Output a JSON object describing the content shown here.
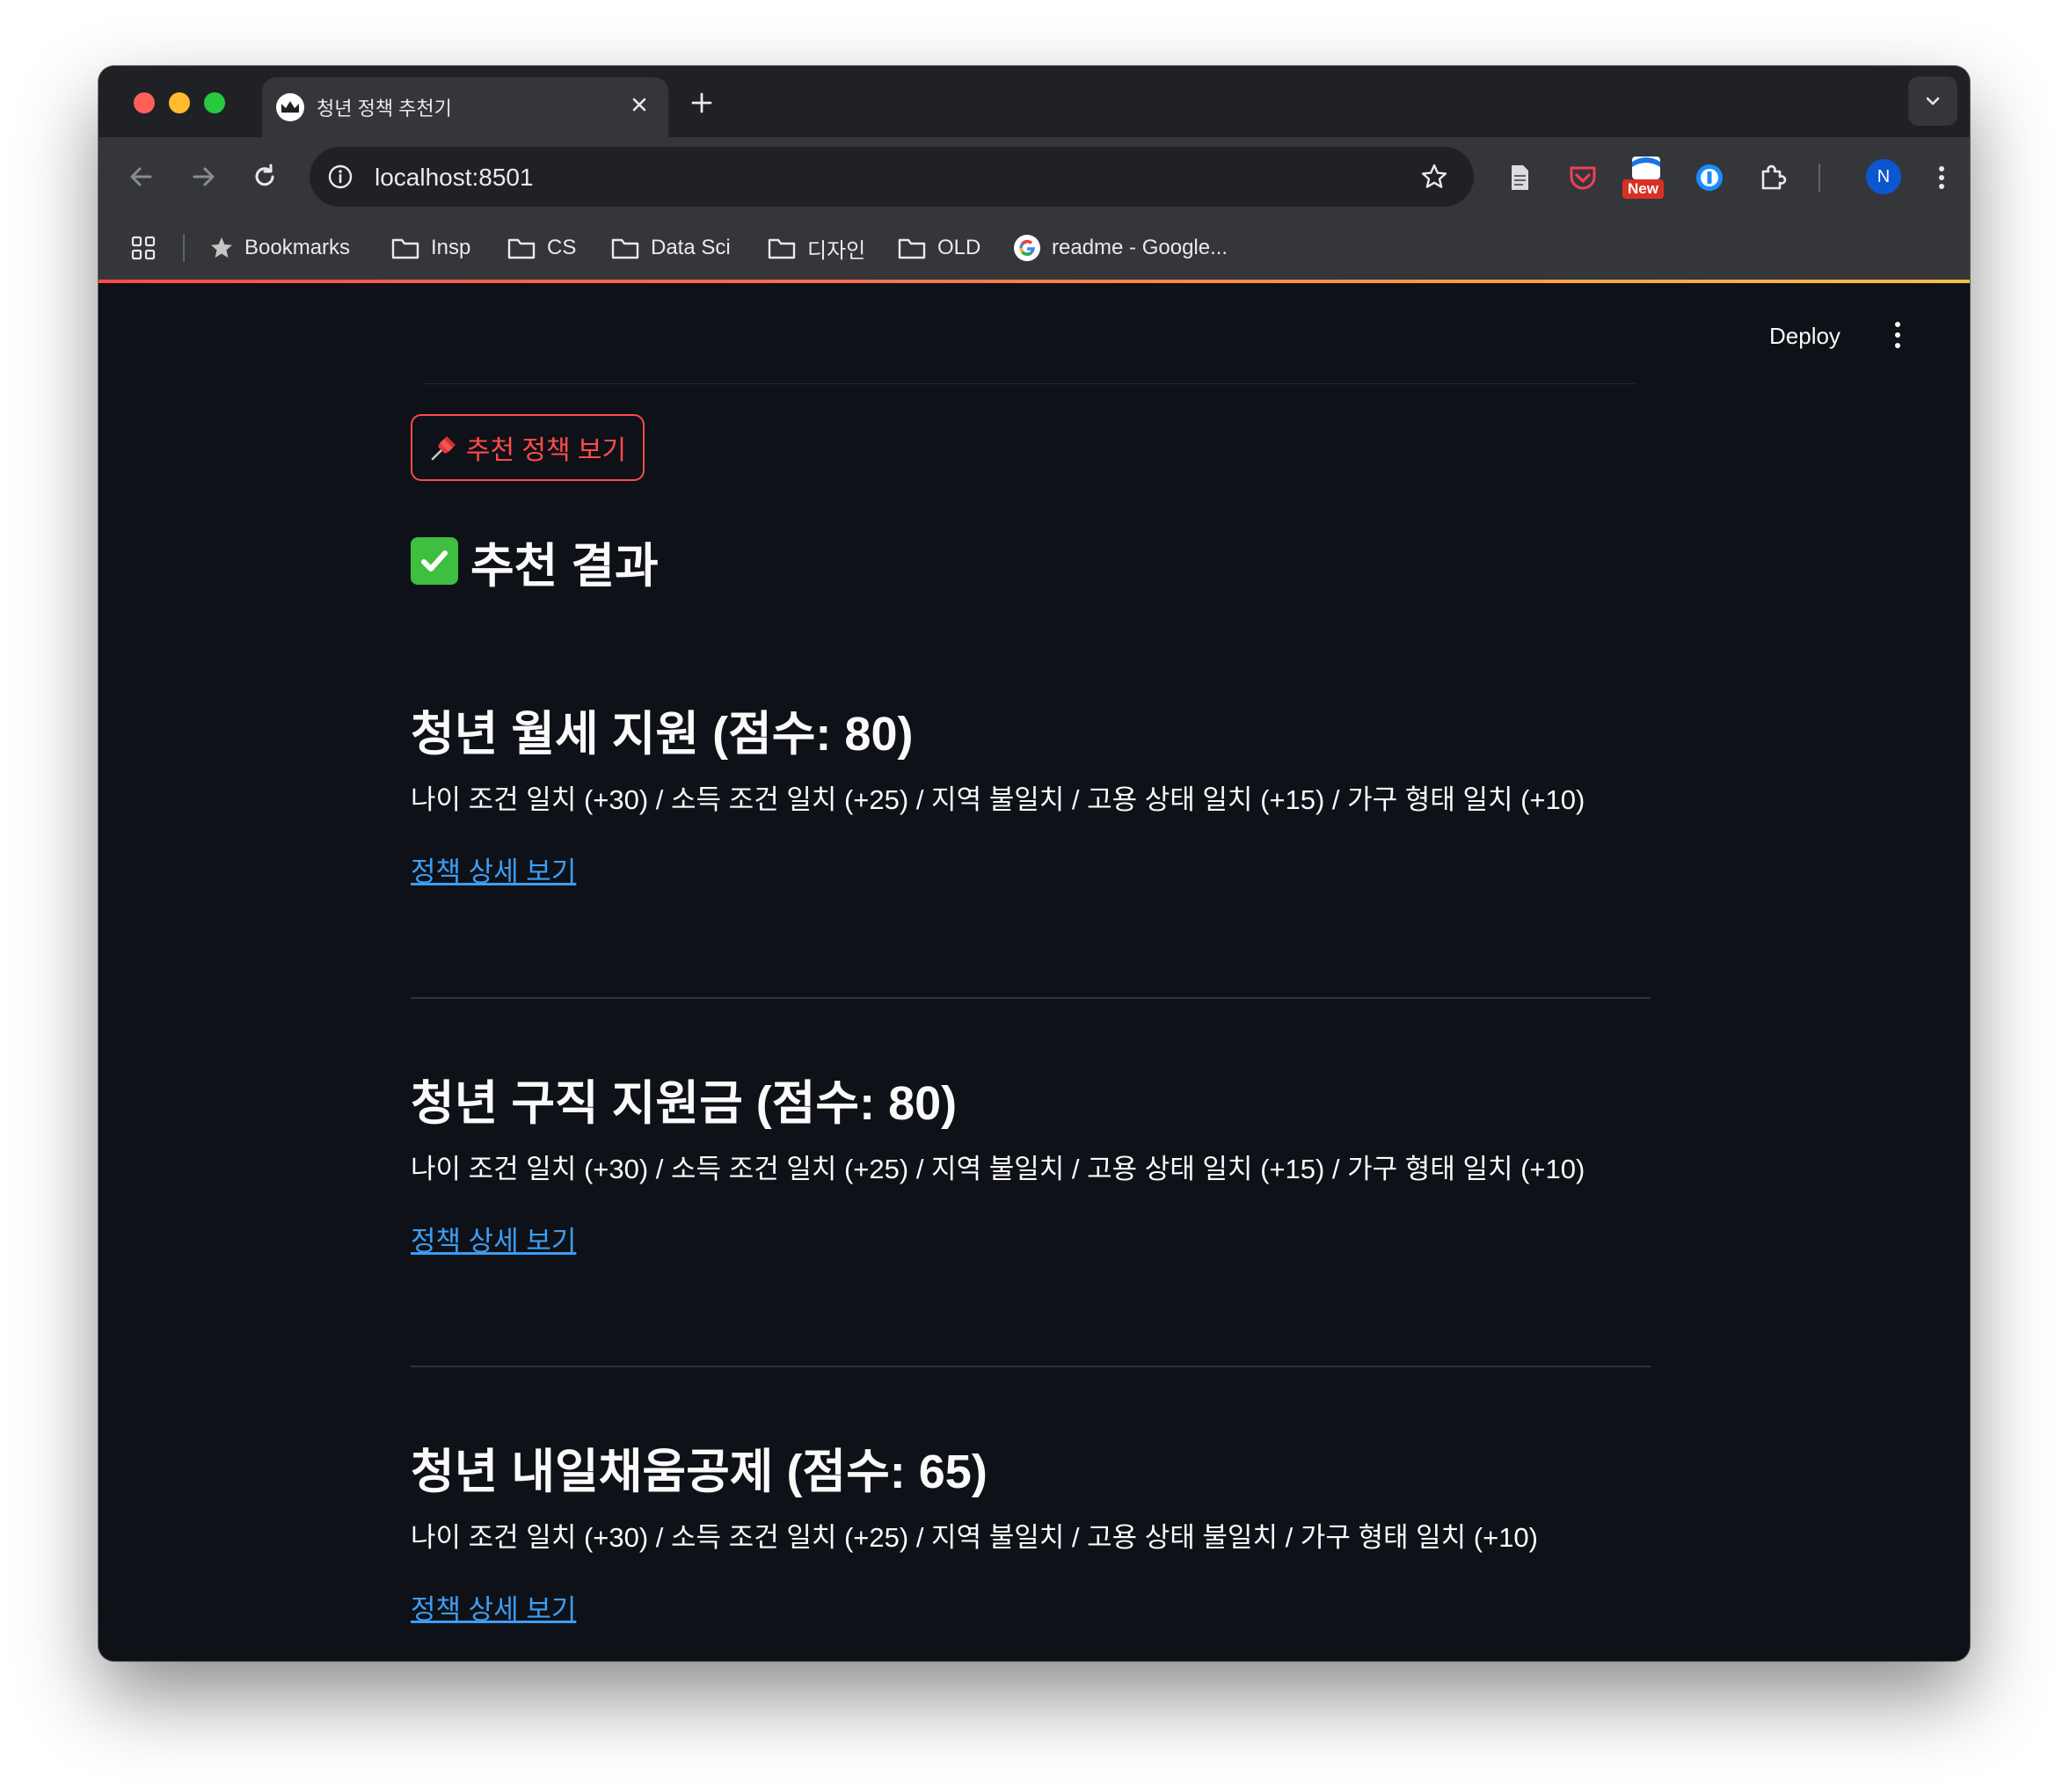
{
  "browser": {
    "tab": {
      "title": "청년 정책 추천기",
      "favicon": "crown-icon"
    },
    "address": {
      "url": "localhost:8501"
    },
    "extensions": {
      "new_badge": "New",
      "avatar_initial": "N"
    },
    "bookmarks": [
      {
        "label": "Bookmarks",
        "icon": "star-icon"
      },
      {
        "label": "Insp",
        "icon": "folder-icon"
      },
      {
        "label": "CS",
        "icon": "folder-icon"
      },
      {
        "label": "Data Sci",
        "icon": "folder-icon"
      },
      {
        "label": "디자인",
        "icon": "folder-icon"
      },
      {
        "label": "OLD",
        "icon": "folder-icon"
      },
      {
        "label": "readme - Google...",
        "icon": "google-icon"
      }
    ]
  },
  "app": {
    "header": {
      "deploy_label": "Deploy"
    },
    "recommend_button": "추천 정책 보기",
    "result_heading": "추천 결과",
    "accent_color": "#ff4b4b",
    "link_color": "#3d9df3",
    "policies": [
      {
        "title": "청년 월세 지원 (점수: 80)",
        "reasons": "나이 조건 일치 (+30) / 소득 조건 일치 (+25) / 지역 불일치 / 고용 상태 일치 (+15) / 가구 형태 일치 (+10)",
        "link": "정책 상세 보기"
      },
      {
        "title": "청년 구직 지원금 (점수: 80)",
        "reasons": "나이 조건 일치 (+30) / 소득 조건 일치 (+25) / 지역 불일치 / 고용 상태 일치 (+15) / 가구 형태 일치 (+10)",
        "link": "정책 상세 보기"
      },
      {
        "title": "청년 내일채움공제 (점수: 65)",
        "reasons": "나이 조건 일치 (+30) / 소득 조건 일치 (+25) / 지역 불일치 / 고용 상태 불일치 / 가구 형태 일치 (+10)",
        "link": "정책 상세 보기"
      }
    ]
  }
}
